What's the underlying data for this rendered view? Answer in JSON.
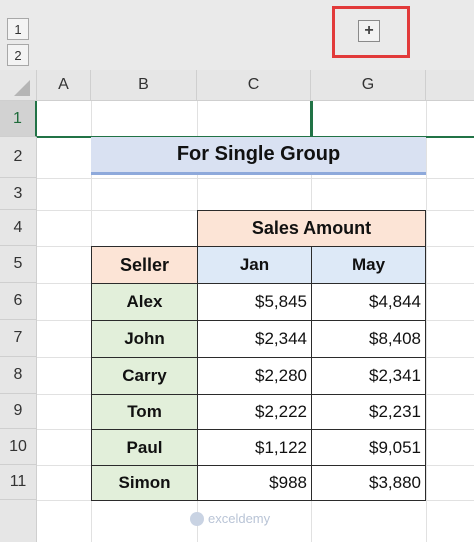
{
  "outline": {
    "levels": [
      "1",
      "2"
    ],
    "expand_symbol": "+"
  },
  "columns": [
    "A",
    "B",
    "C",
    "G"
  ],
  "rows": [
    "1",
    "2",
    "3",
    "4",
    "5",
    "6",
    "7",
    "8",
    "9",
    "10",
    "11"
  ],
  "title": "For Single Group",
  "table": {
    "sales_amount_header": "Sales Amount",
    "seller_header": "Seller",
    "month_headers": [
      "Jan",
      "May"
    ],
    "records": [
      {
        "seller": "Alex",
        "jan": "$5,845",
        "may": "$4,844"
      },
      {
        "seller": "John",
        "jan": "$2,344",
        "may": "$8,408"
      },
      {
        "seller": "Carry",
        "jan": "$2,280",
        "may": "$2,341"
      },
      {
        "seller": "Tom",
        "jan": "$2,222",
        "may": "$2,231"
      },
      {
        "seller": "Paul",
        "jan": "$1,122",
        "may": "$9,051"
      },
      {
        "seller": "Simon",
        "jan": "$988",
        "may": "$3,880"
      }
    ]
  },
  "watermark": "exceldemy",
  "colors": {
    "title_fill": "#d9e1f2",
    "header_pink": "#fce4d6",
    "header_blue": "#dde9f7",
    "seller_fill": "#e2efda",
    "highlight_red": "#e23a3a",
    "excel_green": "#217346"
  }
}
